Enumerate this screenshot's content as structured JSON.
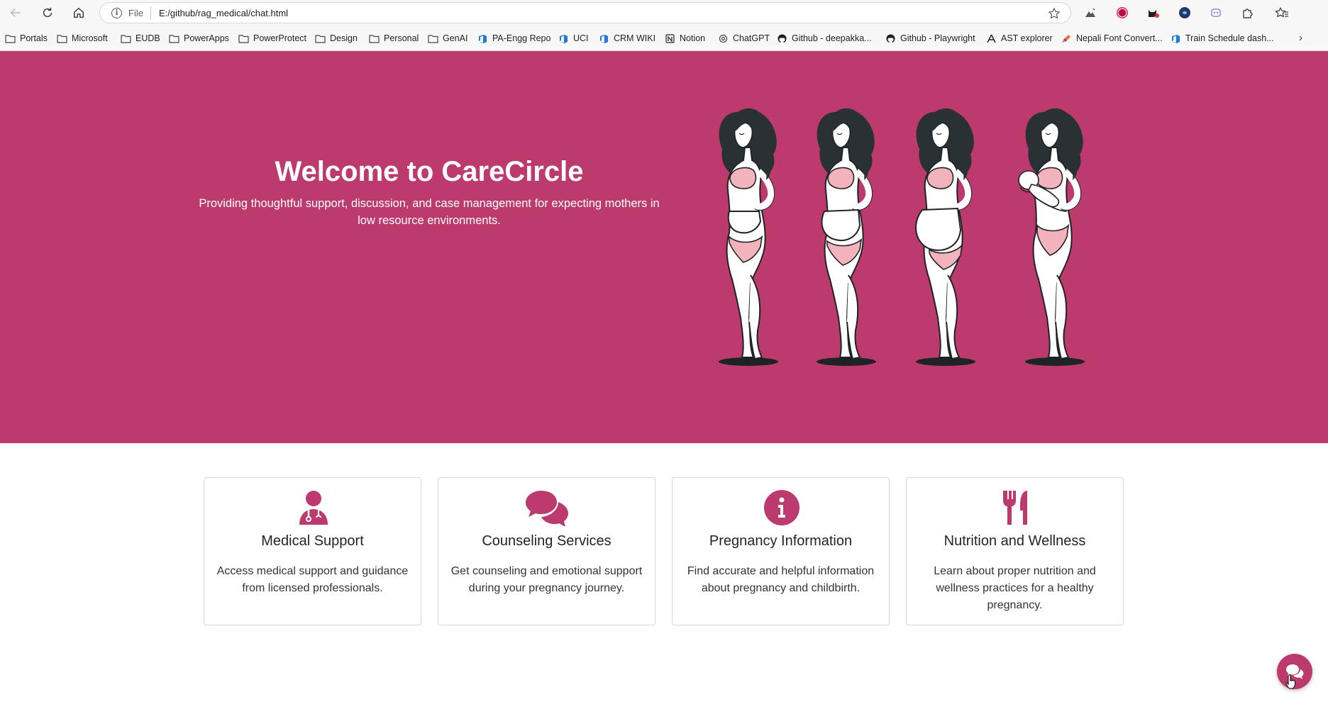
{
  "browser": {
    "address_scheme": "File",
    "address_url": "E:/github/rag_medical/chat.html",
    "bookmarks": [
      {
        "label": "Portals",
        "icon": "folder-icon"
      },
      {
        "label": "Microsoft",
        "icon": "folder-icon"
      },
      {
        "label": "EUDB",
        "icon": "folder-icon"
      },
      {
        "label": "PowerApps",
        "icon": "folder-icon"
      },
      {
        "label": "PowerProtect",
        "icon": "folder-icon"
      },
      {
        "label": "Design",
        "icon": "folder-icon"
      },
      {
        "label": "Personal",
        "icon": "folder-icon"
      },
      {
        "label": "GenAI",
        "icon": "folder-icon"
      },
      {
        "label": "PA-Engg Repo",
        "icon": "azure-devops-icon"
      },
      {
        "label": "UCI",
        "icon": "azure-devops-icon"
      },
      {
        "label": "CRM WIKI",
        "icon": "azure-devops-icon"
      },
      {
        "label": "Notion",
        "icon": "notion-icon"
      },
      {
        "label": "ChatGPT",
        "icon": "chatgpt-icon"
      },
      {
        "label": "Github - deepakka...",
        "icon": "github-icon"
      },
      {
        "label": "Github - Playwright",
        "icon": "github-icon"
      },
      {
        "label": "AST explorer",
        "icon": "ast-explorer-icon"
      },
      {
        "label": "Nepali Font Convert...",
        "icon": "pen-icon"
      },
      {
        "label": "Train Schedule dash...",
        "icon": "azure-devops-icon"
      }
    ]
  },
  "hero": {
    "title": "Welcome to CareCircle",
    "subtitle": "Providing thoughtful support, discussion, and case management for expecting mothers in low resource environments.",
    "illustration": "pregnancy-stages-illustration"
  },
  "cards": [
    {
      "icon": "doctor-icon",
      "title": "Medical Support",
      "text": "Access medical support and guidance from licensed professionals."
    },
    {
      "icon": "comments-icon",
      "title": "Counseling Services",
      "text": "Get counseling and emotional support during your pregnancy journey."
    },
    {
      "icon": "info-icon",
      "title": "Pregnancy Information",
      "text": "Find accurate and helpful information about pregnancy and childbirth."
    },
    {
      "icon": "utensils-icon",
      "title": "Nutrition and Wellness",
      "text": "Learn about proper nutrition and wellness practices for a healthy pregnancy."
    }
  ],
  "colors": {
    "brand": "#bc3a6e",
    "card_border": "#d6d6d6",
    "figure_skin": "#ffffff",
    "figure_hair": "#2a3134",
    "figure_clothing": "#f2b3bd"
  },
  "chat_button": {
    "icon": "chat-bubbles-icon"
  }
}
